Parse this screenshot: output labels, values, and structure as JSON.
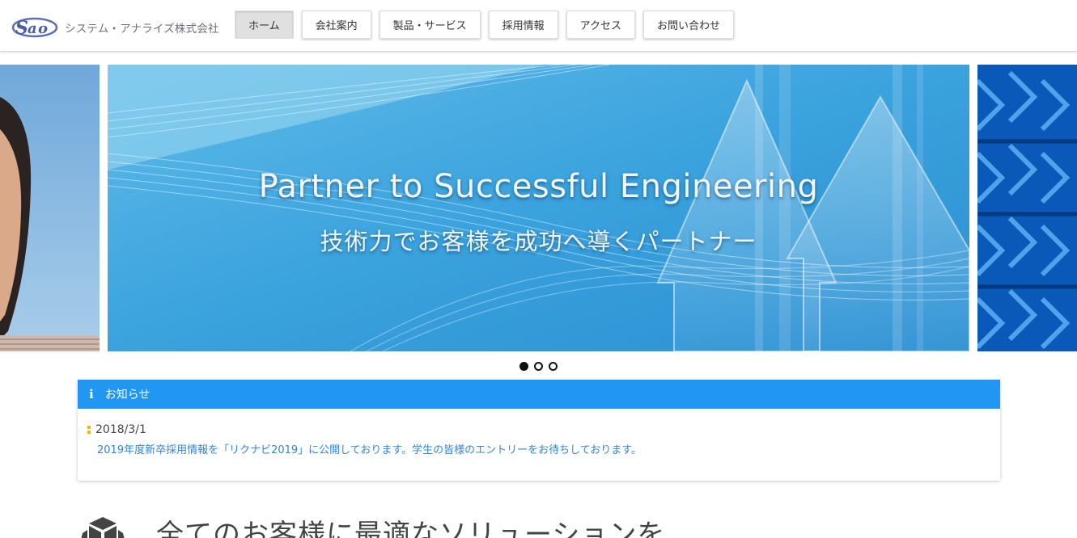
{
  "header": {
    "company_name": "システム・アナライズ株式会社",
    "logo_icon": "sao-logo-icon"
  },
  "nav": [
    {
      "label": "ホーム",
      "active": true
    },
    {
      "label": "会社案内",
      "active": false
    },
    {
      "label": "製品・サービス",
      "active": false
    },
    {
      "label": "採用情報",
      "active": false
    },
    {
      "label": "アクセス",
      "active": false
    },
    {
      "label": "お問い合わせ",
      "active": false
    }
  ],
  "carousel": {
    "title": "Partner to Successful Engineering",
    "subtitle": "技術力でお客様を成功へ導くパートナー",
    "slide_count": 3,
    "active_index": 0
  },
  "news": {
    "heading": "お知らせ",
    "heading_icon": "info-icon",
    "items": [
      {
        "date": "2018/3/1",
        "text": "2019年度新卒採用情報を「リクナビ2019」に公開しております。学生の皆様のエントリーをお待ちしております。"
      }
    ]
  },
  "section": {
    "title": "全てのお客様に最適なソリューションを",
    "icon": "cube-icon"
  },
  "colors": {
    "accent": "#2196f3",
    "link": "#2f87e0",
    "bullet": "#f5b800",
    "slide_blue": "#3fa2dd"
  }
}
